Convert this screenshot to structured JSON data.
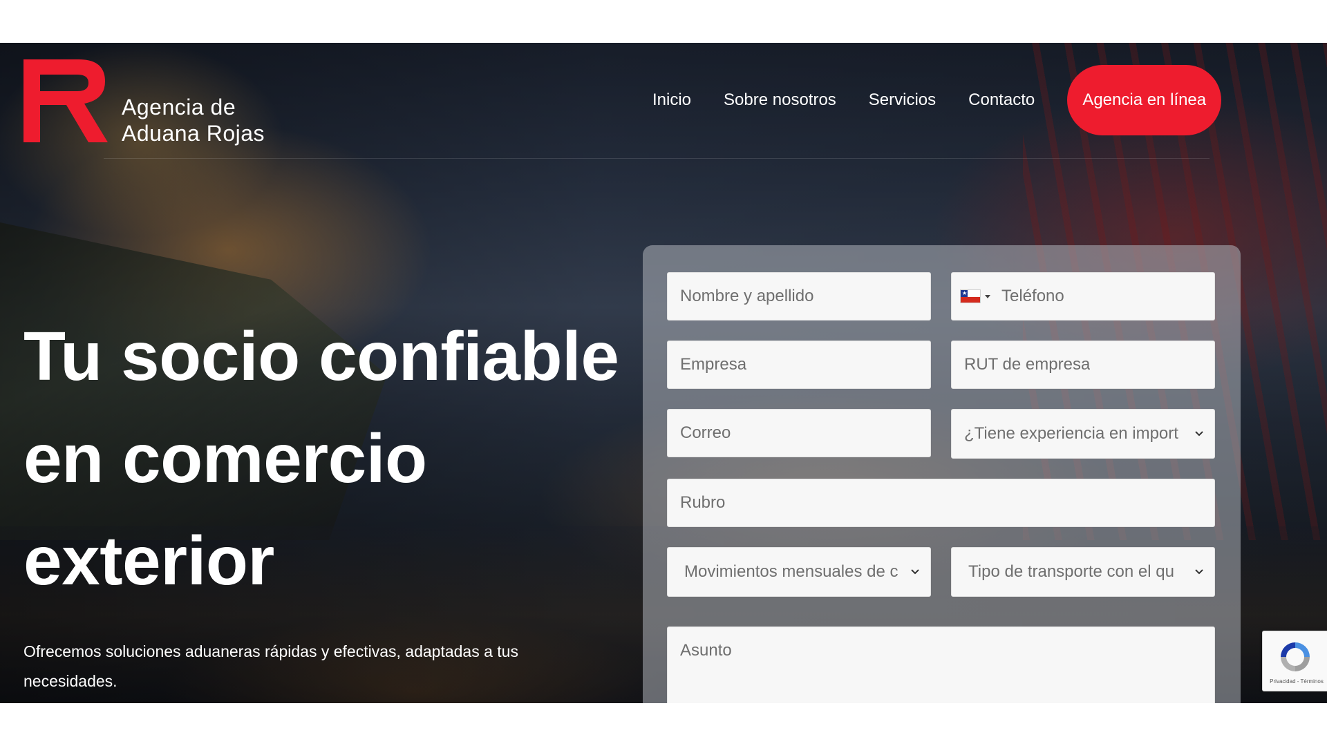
{
  "brand": {
    "name_line1": "Agencia de",
    "name_line2": "Aduana Rojas",
    "accent_color": "#ee1c2e",
    "logo_icon": "r-logo-icon"
  },
  "nav": {
    "items": [
      {
        "label": "Inicio"
      },
      {
        "label": "Sobre nosotros"
      },
      {
        "label": "Servicios"
      },
      {
        "label": "Contacto"
      }
    ],
    "cta_label": "Agencia en línea"
  },
  "hero": {
    "headline": "Tu socio confiable en comercio exterior",
    "subtext": "Ofrecemos soluciones aduaneras rápidas y efectivas, adaptadas a tus necesidades."
  },
  "form": {
    "name_placeholder": "Nombre y apellido",
    "phone_placeholder": "Teléfono",
    "phone_country_icon": "chile-flag-icon",
    "company_placeholder": "Empresa",
    "rut_placeholder": "RUT de empresa",
    "email_placeholder": "Correo",
    "experience_select": "¿Tiene experiencia en import",
    "industry_placeholder": "Rubro",
    "monthly_select": "Movimientos mensuales de c",
    "transport_select": "Tipo de transporte con el qu",
    "subject_placeholder": "Asunto"
  },
  "recaptcha": {
    "icon": "recaptcha-icon",
    "links": "Privacidad - Términos"
  }
}
